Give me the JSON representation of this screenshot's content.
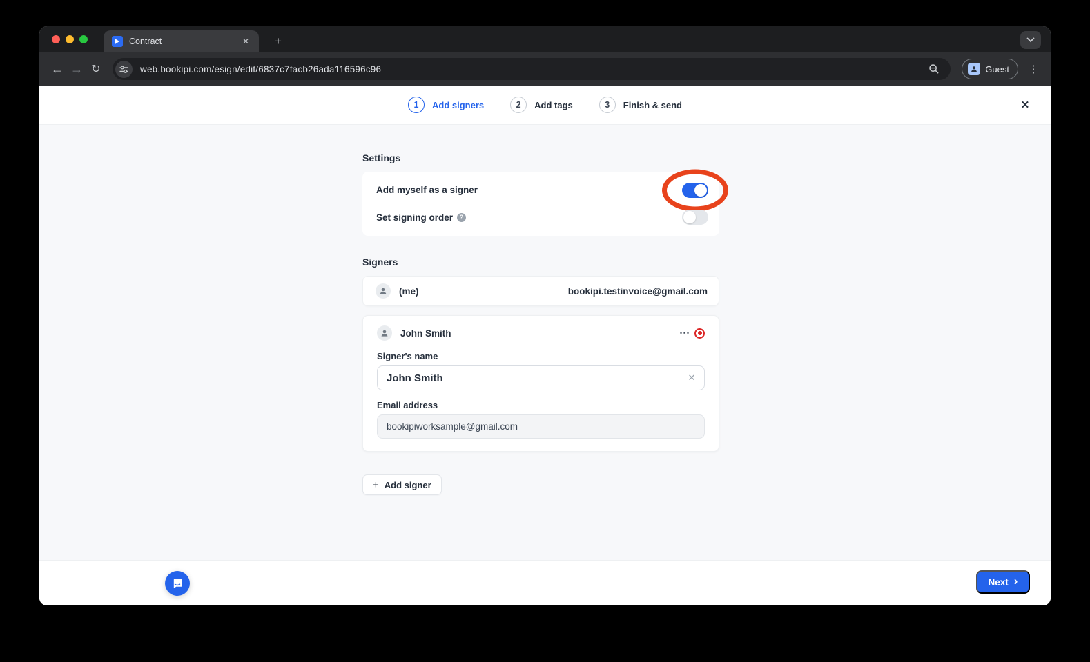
{
  "browser": {
    "tab_title": "Contract",
    "url": "web.bookipi.com/esign/edit/6837c7facb26ada116596c96",
    "profile_label": "Guest",
    "icons": {
      "back": "←",
      "forward": "→",
      "reload": "↻",
      "new_tab": "+",
      "tab_close": "✕",
      "menu_dots": "⋮"
    }
  },
  "stepper": {
    "steps": [
      {
        "number": "1",
        "label": "Add signers"
      },
      {
        "number": "2",
        "label": "Add tags"
      },
      {
        "number": "3",
        "label": "Finish & send"
      }
    ],
    "close_icon": "✕"
  },
  "settings": {
    "heading": "Settings",
    "rows": [
      {
        "label": "Add myself as a signer",
        "toggle_state": "on"
      },
      {
        "label": "Set signing order",
        "toggle_state": "off",
        "help_icon": "?"
      }
    ]
  },
  "signers": {
    "heading": "Signers",
    "me": {
      "name": "(me)",
      "email": "bookipi.testinvoice@gmail.com"
    },
    "signer": {
      "display_name": "John Smith",
      "more_icon": "⋯",
      "name_label": "Signer's name",
      "name_value": "John Smith",
      "clear_icon": "✕",
      "email_label": "Email address",
      "email_value": "bookipiworksample@gmail.com"
    },
    "add_button_label": "Add signer",
    "add_button_icon": "+"
  },
  "footer": {
    "next_label": "Next",
    "next_icon": "›"
  },
  "colors": {
    "accent_blue": "#2463eb",
    "annotation_red": "#e8431c",
    "delete_red": "#dc2626",
    "page_bg": "#f7f8fa",
    "browser_dark": "#2e2f32"
  }
}
